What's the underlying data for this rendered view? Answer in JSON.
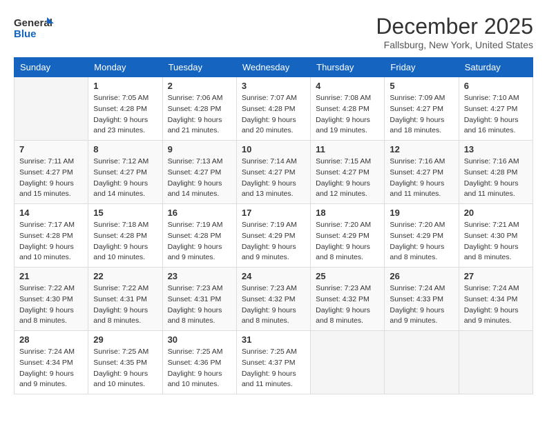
{
  "header": {
    "logo_line1": "General",
    "logo_line2": "Blue",
    "month_title": "December 2025",
    "location": "Fallsburg, New York, United States"
  },
  "weekdays": [
    "Sunday",
    "Monday",
    "Tuesday",
    "Wednesday",
    "Thursday",
    "Friday",
    "Saturday"
  ],
  "weeks": [
    [
      {
        "day": "",
        "sunrise": "",
        "sunset": "",
        "daylight": ""
      },
      {
        "day": "1",
        "sunrise": "Sunrise: 7:05 AM",
        "sunset": "Sunset: 4:28 PM",
        "daylight": "Daylight: 9 hours and 23 minutes."
      },
      {
        "day": "2",
        "sunrise": "Sunrise: 7:06 AM",
        "sunset": "Sunset: 4:28 PM",
        "daylight": "Daylight: 9 hours and 21 minutes."
      },
      {
        "day": "3",
        "sunrise": "Sunrise: 7:07 AM",
        "sunset": "Sunset: 4:28 PM",
        "daylight": "Daylight: 9 hours and 20 minutes."
      },
      {
        "day": "4",
        "sunrise": "Sunrise: 7:08 AM",
        "sunset": "Sunset: 4:28 PM",
        "daylight": "Daylight: 9 hours and 19 minutes."
      },
      {
        "day": "5",
        "sunrise": "Sunrise: 7:09 AM",
        "sunset": "Sunset: 4:27 PM",
        "daylight": "Daylight: 9 hours and 18 minutes."
      },
      {
        "day": "6",
        "sunrise": "Sunrise: 7:10 AM",
        "sunset": "Sunset: 4:27 PM",
        "daylight": "Daylight: 9 hours and 16 minutes."
      }
    ],
    [
      {
        "day": "7",
        "sunrise": "Sunrise: 7:11 AM",
        "sunset": "Sunset: 4:27 PM",
        "daylight": "Daylight: 9 hours and 15 minutes."
      },
      {
        "day": "8",
        "sunrise": "Sunrise: 7:12 AM",
        "sunset": "Sunset: 4:27 PM",
        "daylight": "Daylight: 9 hours and 14 minutes."
      },
      {
        "day": "9",
        "sunrise": "Sunrise: 7:13 AM",
        "sunset": "Sunset: 4:27 PM",
        "daylight": "Daylight: 9 hours and 14 minutes."
      },
      {
        "day": "10",
        "sunrise": "Sunrise: 7:14 AM",
        "sunset": "Sunset: 4:27 PM",
        "daylight": "Daylight: 9 hours and 13 minutes."
      },
      {
        "day": "11",
        "sunrise": "Sunrise: 7:15 AM",
        "sunset": "Sunset: 4:27 PM",
        "daylight": "Daylight: 9 hours and 12 minutes."
      },
      {
        "day": "12",
        "sunrise": "Sunrise: 7:16 AM",
        "sunset": "Sunset: 4:27 PM",
        "daylight": "Daylight: 9 hours and 11 minutes."
      },
      {
        "day": "13",
        "sunrise": "Sunrise: 7:16 AM",
        "sunset": "Sunset: 4:28 PM",
        "daylight": "Daylight: 9 hours and 11 minutes."
      }
    ],
    [
      {
        "day": "14",
        "sunrise": "Sunrise: 7:17 AM",
        "sunset": "Sunset: 4:28 PM",
        "daylight": "Daylight: 9 hours and 10 minutes."
      },
      {
        "day": "15",
        "sunrise": "Sunrise: 7:18 AM",
        "sunset": "Sunset: 4:28 PM",
        "daylight": "Daylight: 9 hours and 10 minutes."
      },
      {
        "day": "16",
        "sunrise": "Sunrise: 7:19 AM",
        "sunset": "Sunset: 4:28 PM",
        "daylight": "Daylight: 9 hours and 9 minutes."
      },
      {
        "day": "17",
        "sunrise": "Sunrise: 7:19 AM",
        "sunset": "Sunset: 4:29 PM",
        "daylight": "Daylight: 9 hours and 9 minutes."
      },
      {
        "day": "18",
        "sunrise": "Sunrise: 7:20 AM",
        "sunset": "Sunset: 4:29 PM",
        "daylight": "Daylight: 9 hours and 8 minutes."
      },
      {
        "day": "19",
        "sunrise": "Sunrise: 7:20 AM",
        "sunset": "Sunset: 4:29 PM",
        "daylight": "Daylight: 9 hours and 8 minutes."
      },
      {
        "day": "20",
        "sunrise": "Sunrise: 7:21 AM",
        "sunset": "Sunset: 4:30 PM",
        "daylight": "Daylight: 9 hours and 8 minutes."
      }
    ],
    [
      {
        "day": "21",
        "sunrise": "Sunrise: 7:22 AM",
        "sunset": "Sunset: 4:30 PM",
        "daylight": "Daylight: 9 hours and 8 minutes."
      },
      {
        "day": "22",
        "sunrise": "Sunrise: 7:22 AM",
        "sunset": "Sunset: 4:31 PM",
        "daylight": "Daylight: 9 hours and 8 minutes."
      },
      {
        "day": "23",
        "sunrise": "Sunrise: 7:23 AM",
        "sunset": "Sunset: 4:31 PM",
        "daylight": "Daylight: 9 hours and 8 minutes."
      },
      {
        "day": "24",
        "sunrise": "Sunrise: 7:23 AM",
        "sunset": "Sunset: 4:32 PM",
        "daylight": "Daylight: 9 hours and 8 minutes."
      },
      {
        "day": "25",
        "sunrise": "Sunrise: 7:23 AM",
        "sunset": "Sunset: 4:32 PM",
        "daylight": "Daylight: 9 hours and 8 minutes."
      },
      {
        "day": "26",
        "sunrise": "Sunrise: 7:24 AM",
        "sunset": "Sunset: 4:33 PM",
        "daylight": "Daylight: 9 hours and 9 minutes."
      },
      {
        "day": "27",
        "sunrise": "Sunrise: 7:24 AM",
        "sunset": "Sunset: 4:34 PM",
        "daylight": "Daylight: 9 hours and 9 minutes."
      }
    ],
    [
      {
        "day": "28",
        "sunrise": "Sunrise: 7:24 AM",
        "sunset": "Sunset: 4:34 PM",
        "daylight": "Daylight: 9 hours and 9 minutes."
      },
      {
        "day": "29",
        "sunrise": "Sunrise: 7:25 AM",
        "sunset": "Sunset: 4:35 PM",
        "daylight": "Daylight: 9 hours and 10 minutes."
      },
      {
        "day": "30",
        "sunrise": "Sunrise: 7:25 AM",
        "sunset": "Sunset: 4:36 PM",
        "daylight": "Daylight: 9 hours and 10 minutes."
      },
      {
        "day": "31",
        "sunrise": "Sunrise: 7:25 AM",
        "sunset": "Sunset: 4:37 PM",
        "daylight": "Daylight: 9 hours and 11 minutes."
      },
      {
        "day": "",
        "sunrise": "",
        "sunset": "",
        "daylight": ""
      },
      {
        "day": "",
        "sunrise": "",
        "sunset": "",
        "daylight": ""
      },
      {
        "day": "",
        "sunrise": "",
        "sunset": "",
        "daylight": ""
      }
    ]
  ]
}
